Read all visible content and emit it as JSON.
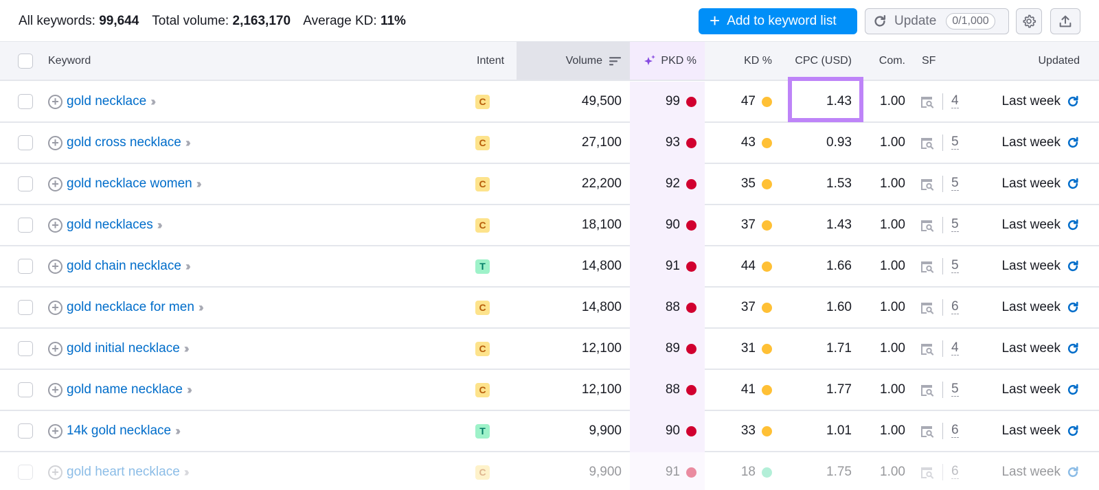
{
  "summary": {
    "all_keywords_label": "All keywords:",
    "all_keywords_value": "99,644",
    "total_volume_label": "Total volume:",
    "total_volume_value": "2,163,170",
    "average_kd_label": "Average KD:",
    "average_kd_value": "11%"
  },
  "toolbar": {
    "add_label": "Add to keyword list",
    "update_label": "Update",
    "update_count": "0/1,000",
    "gear_icon": "gear-icon",
    "export_icon": "export-icon"
  },
  "columns": {
    "keyword": "Keyword",
    "intent": "Intent",
    "volume": "Volume",
    "pkd": "PKD %",
    "kd": "KD %",
    "cpc": "CPC (USD)",
    "com": "Com.",
    "sf": "SF",
    "updated": "Updated"
  },
  "colors": {
    "accent": "#008ff8",
    "link": "#006dca",
    "pkd_red": "#d1002f",
    "kd_yellow": "#ffc035",
    "kd_green": "#59ddaa",
    "highlight": "#be84f8"
  },
  "rows": [
    {
      "keyword": "gold necklace",
      "intent": "C",
      "volume": "49,500",
      "pkd": "99",
      "kd": "47",
      "cpc": "1.43",
      "com": "1.00",
      "sf": "4",
      "updated": "Last week"
    },
    {
      "keyword": "gold cross necklace",
      "intent": "C",
      "volume": "27,100",
      "pkd": "93",
      "kd": "43",
      "cpc": "0.93",
      "com": "1.00",
      "sf": "5",
      "updated": "Last week"
    },
    {
      "keyword": "gold necklace women",
      "intent": "C",
      "volume": "22,200",
      "pkd": "92",
      "kd": "35",
      "cpc": "1.53",
      "com": "1.00",
      "sf": "5",
      "updated": "Last week"
    },
    {
      "keyword": "gold necklaces",
      "intent": "C",
      "volume": "18,100",
      "pkd": "90",
      "kd": "37",
      "cpc": "1.43",
      "com": "1.00",
      "sf": "5",
      "updated": "Last week"
    },
    {
      "keyword": "gold chain necklace",
      "intent": "T",
      "volume": "14,800",
      "pkd": "91",
      "kd": "44",
      "cpc": "1.66",
      "com": "1.00",
      "sf": "5",
      "updated": "Last week"
    },
    {
      "keyword": "gold necklace for men",
      "intent": "C",
      "volume": "14,800",
      "pkd": "88",
      "kd": "37",
      "cpc": "1.60",
      "com": "1.00",
      "sf": "6",
      "updated": "Last week"
    },
    {
      "keyword": "gold initial necklace",
      "intent": "C",
      "volume": "12,100",
      "pkd": "89",
      "kd": "31",
      "cpc": "1.71",
      "com": "1.00",
      "sf": "4",
      "updated": "Last week"
    },
    {
      "keyword": "gold name necklace",
      "intent": "C",
      "volume": "12,100",
      "pkd": "88",
      "kd": "41",
      "cpc": "1.77",
      "com": "1.00",
      "sf": "5",
      "updated": "Last week"
    },
    {
      "keyword": "14k gold necklace",
      "intent": "T",
      "volume": "9,900",
      "pkd": "90",
      "kd": "33",
      "cpc": "1.01",
      "com": "1.00",
      "sf": "6",
      "updated": "Last week"
    },
    {
      "keyword": "gold heart necklace",
      "intent": "C",
      "volume": "9,900",
      "pkd": "91",
      "kd": "18",
      "cpc": "1.75",
      "com": "1.00",
      "sf": "6",
      "updated": "Last week"
    }
  ]
}
